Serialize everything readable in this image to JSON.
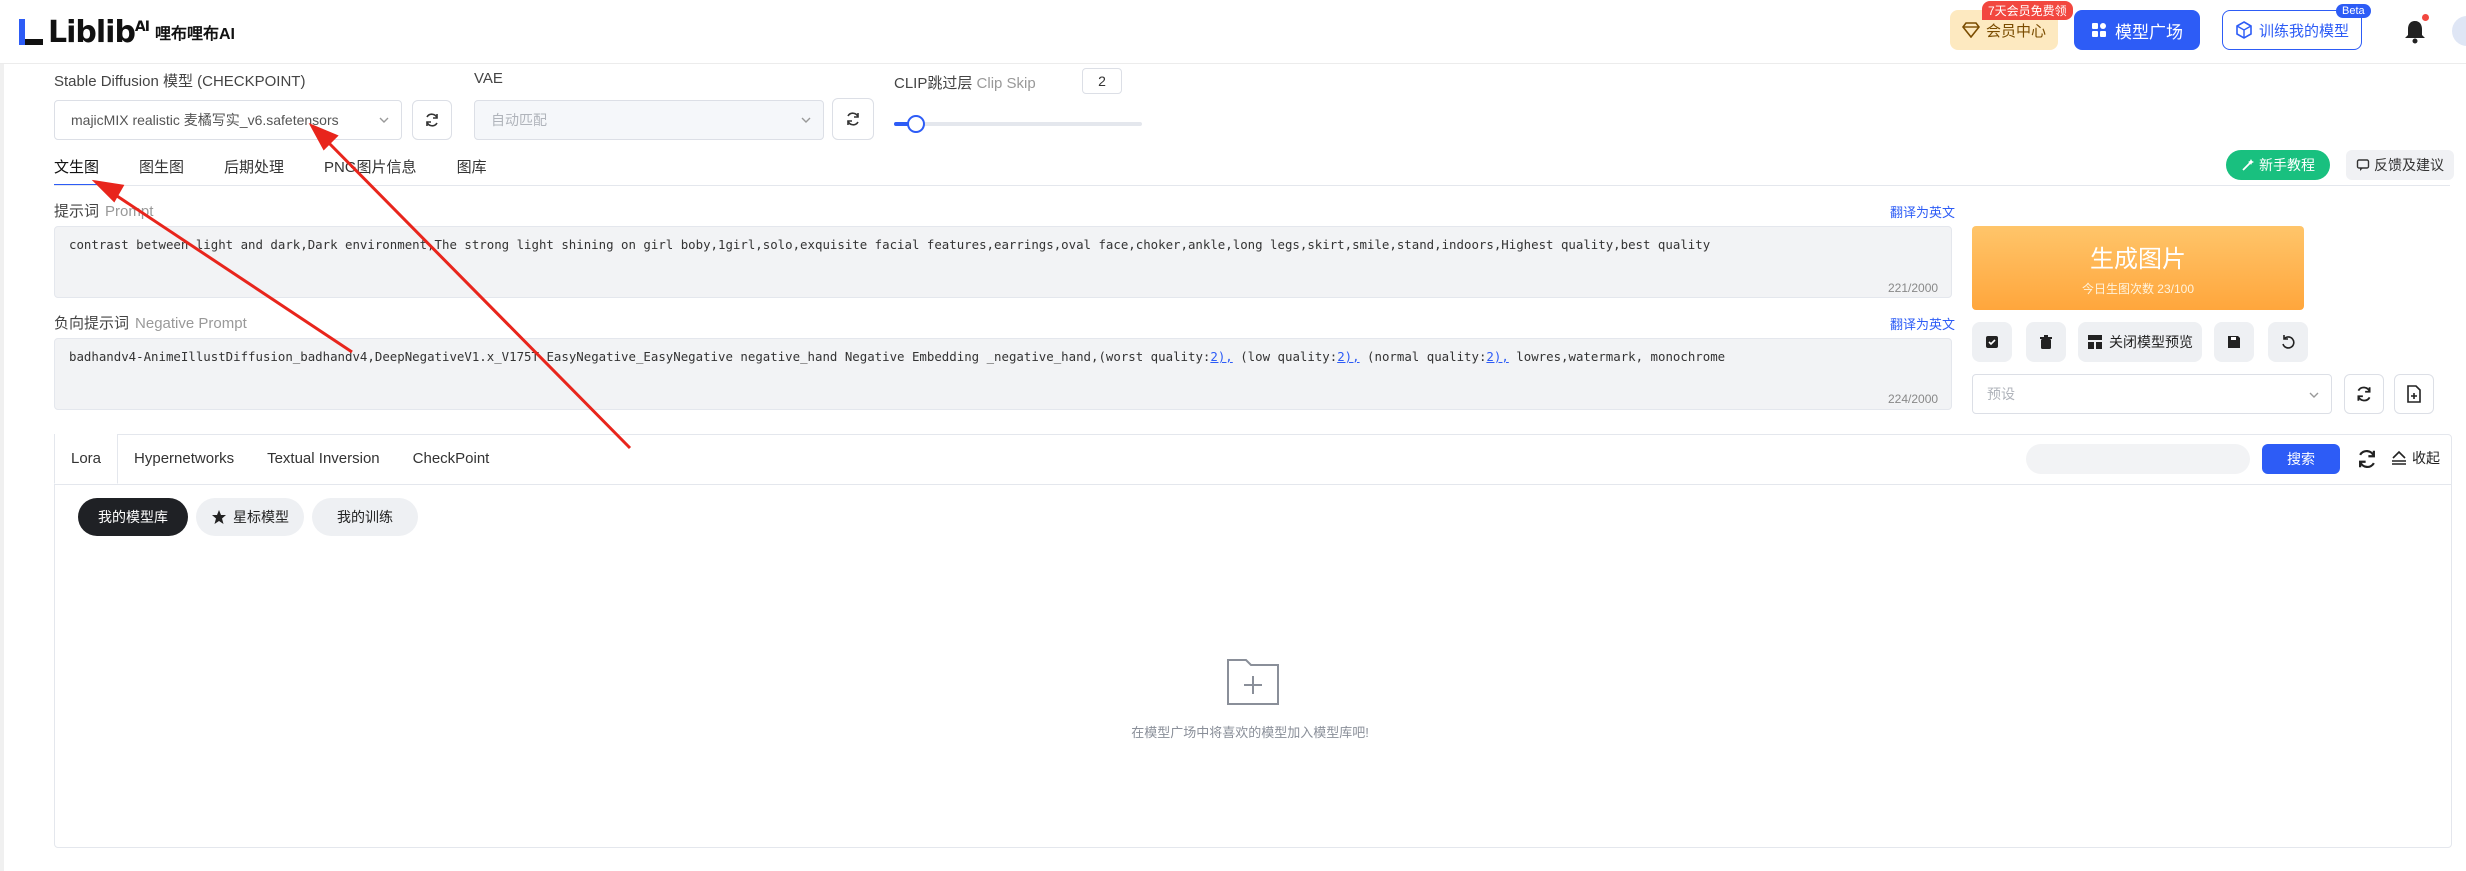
{
  "header": {
    "logo_text": "Liblib",
    "logo_ai": "AI",
    "logo_cn": "哩布哩布AI",
    "vip_label": "会员中心",
    "vip_badge": "7天会员免费领",
    "models_label": "模型广场",
    "train_label": "训练我的模型",
    "train_badge": "Beta",
    "colors": {
      "primary": "#2d5cf6",
      "vip_bg": "#fde9c0",
      "badge_red": "#f2473f"
    }
  },
  "settings": {
    "checkpoint_label": "Stable Diffusion 模型 (CHECKPOINT)",
    "checkpoint_value": "majicMIX realistic 麦橘写实_v6.safetensors",
    "vae_label": "VAE",
    "vae_value": "自动匹配",
    "clip_label": "CLIP跳过层",
    "clip_label_en": "Clip Skip",
    "clip_value": "2",
    "clip_slider_fraction": 0.09
  },
  "tabs": [
    "文生图",
    "图生图",
    "后期处理",
    "PNG图片信息",
    "图库"
  ],
  "active_tab": "文生图",
  "actions": {
    "tutorial_label": "新手教程",
    "feedback_label": "反馈及建议"
  },
  "prompt": {
    "label": "提示词",
    "label_en": "Prompt",
    "translate": "翻译为英文",
    "text": "contrast between light and dark,Dark environment,The strong light shining on girl boby,1girl,solo,exquisite facial features,earrings,oval face,choker,ankle,long legs,skirt,smile,stand,indoors,Highest quality,best quality",
    "counter": "221/2000"
  },
  "negative_prompt": {
    "label": "负向提示词",
    "label_en": "Negative Prompt",
    "translate": "翻译为英文",
    "text_a": "badhandv4-AnimeIllustDiffusion_badhandv4",
    "text_b": ",DeepNegativeV1.x_V175T EasyNegative_EasyNegative negative_hand Negative Embedding _negative_hand,(worst quality:",
    "w1": "2),",
    "text_c": " (low quality:",
    "w2": "2),",
    "text_d": " (normal quality:",
    "w3": "2),",
    "text_e": " lowres,watermark, monochrome",
    "counter": "224/2000"
  },
  "generate": {
    "label": "生成图片",
    "sub": "今日生图次数 23/100",
    "preview_label": "关闭模型预览",
    "preset_placeholder": "预设"
  },
  "lower_panel": {
    "tabs": [
      "Lora",
      "Hypernetworks",
      "Textual Inversion",
      "CheckPoint"
    ],
    "active_tab": "Lora",
    "search_button": "搜索",
    "collapse_label": "收起",
    "pills": [
      "我的模型库",
      "星标模型",
      "我的训练"
    ],
    "empty_text": "在模型广场中将喜欢的模型加入模型库吧!"
  }
}
